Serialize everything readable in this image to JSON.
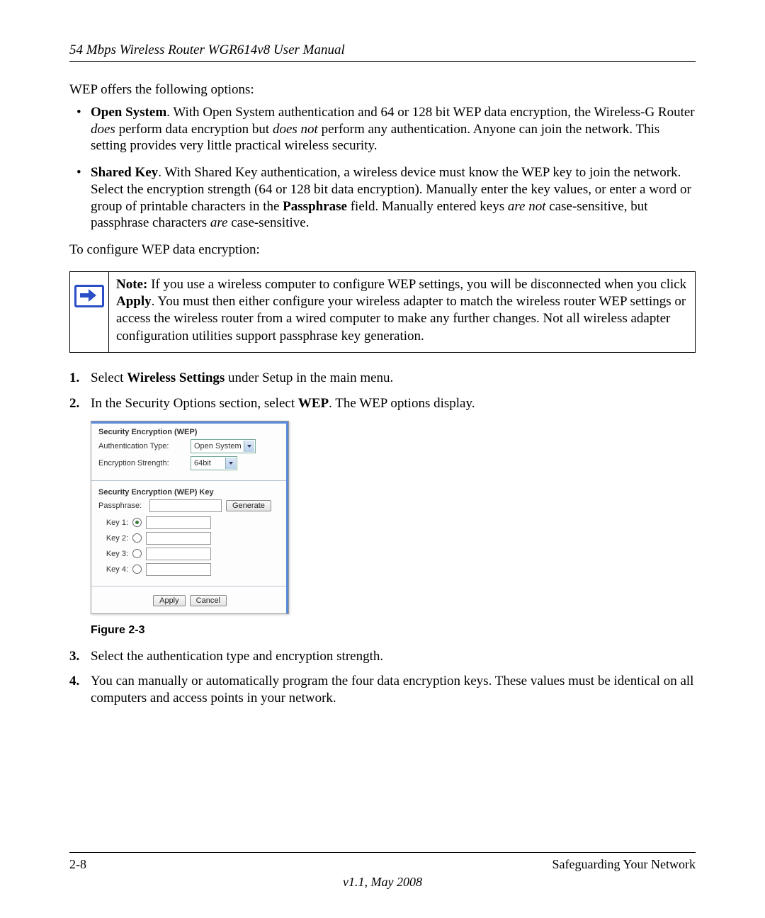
{
  "header": {
    "running_head": "54 Mbps Wireless Router WGR614v8 User Manual"
  },
  "intro": "WEP offers the following options:",
  "bullets": {
    "open_system": {
      "title": "Open System",
      "rest1": ". With Open System authentication and 64 or 128 bit WEP data encryption, the Wireless-G Router ",
      "em1": "does",
      "rest2": " perform data encryption but ",
      "em2": "does not",
      "rest3": " perform any authentication. Anyone can join the network. This setting provides very little practical wireless security."
    },
    "shared_key": {
      "title": "Shared Key",
      "rest1": ". With Shared Key authentication, a wireless device must know the WEP key to join the network. Select the encryption strength (64 or 128 bit data encryption). Manually enter the key values, or enter a word or group of printable characters in the ",
      "b1": "Passphrase",
      "rest2": " field. Manually entered keys ",
      "em1": "are not",
      "rest3": " case-sensitive, but passphrase characters ",
      "em2": "are",
      "rest4": " case-sensitive."
    }
  },
  "configure_line": "To configure WEP data encryption:",
  "note": {
    "label": "Note:",
    "text1": " If you use a wireless computer to configure WEP settings, you will be disconnected when you click ",
    "apply": "Apply",
    "text2": ". You must then either configure your wireless adapter to match the wireless router WEP settings or access the wireless router from a wired computer to make any further changes. Not all wireless adapter configuration utilities support passphrase key generation."
  },
  "steps": {
    "s1": {
      "num": "1.",
      "pre": "Select ",
      "b": "Wireless Settings",
      "post": " under Setup in the main menu."
    },
    "s2": {
      "num": "2.",
      "pre": "In the Security Options section, select ",
      "b": "WEP",
      "post": ". The WEP options display."
    },
    "s3": {
      "num": "3.",
      "text": "Select the authentication type and encryption strength."
    },
    "s4": {
      "num": "4.",
      "text": "You can manually or automatically program the four data encryption keys. These values must be identical on all computers and access points in your network."
    }
  },
  "figure": {
    "title1": "Security Encryption (WEP)",
    "auth_label": "Authentication Type:",
    "auth_value": "Open System",
    "enc_label": "Encryption Strength:",
    "enc_value": "64bit",
    "title2": "Security Encryption (WEP) Key",
    "pass_label": "Passphrase:",
    "generate": "Generate",
    "key1": "Key 1:",
    "key2": "Key 2:",
    "key3": "Key 3:",
    "key4": "Key 4:",
    "apply": "Apply",
    "cancel": "Cancel",
    "caption": "Figure 2-3"
  },
  "footer": {
    "page": "2-8",
    "section": "Safeguarding Your Network",
    "version": "v1.1, May 2008"
  }
}
